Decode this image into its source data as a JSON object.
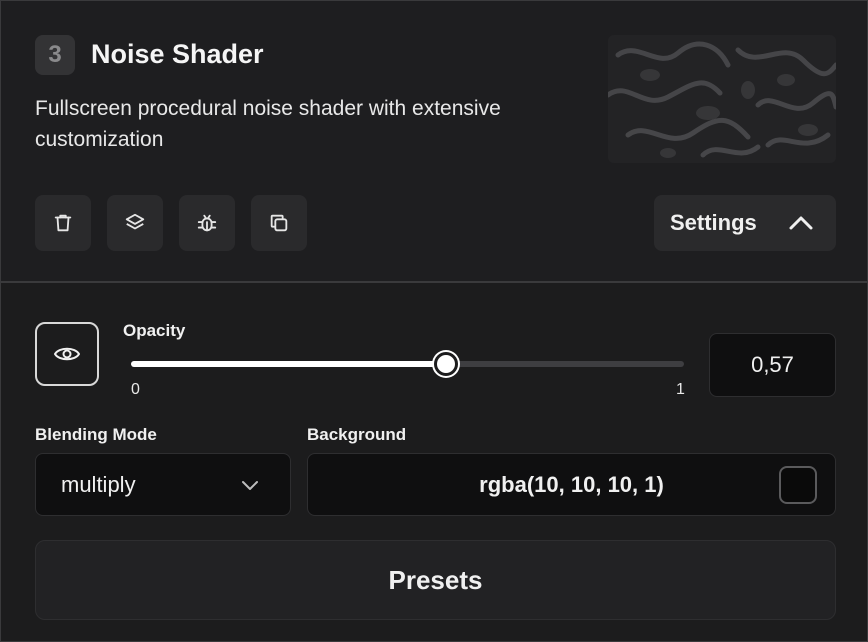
{
  "layer": {
    "index": "3",
    "title": "Noise Shader",
    "description": "Fullscreen procedural noise shader with extensive customization"
  },
  "toolbar": {
    "icons": [
      "trash-icon",
      "layers-icon",
      "bug-icon",
      "copy-icon"
    ],
    "settings_label": "Settings"
  },
  "opacity": {
    "label": "Opacity",
    "value": 0.57,
    "display_value": "0,57",
    "min_label": "0",
    "max_label": "1"
  },
  "blending": {
    "label": "Blending Mode",
    "selected": "multiply"
  },
  "background": {
    "label": "Background",
    "value": "rgba(10, 10, 10, 1)",
    "swatch_color": "#0a0a0a"
  },
  "presets_label": "Presets",
  "colors": {
    "panel": "#1c1c1d",
    "control": "#2a2a2c",
    "field": "#0f0f10",
    "accent": "#ffffff"
  }
}
